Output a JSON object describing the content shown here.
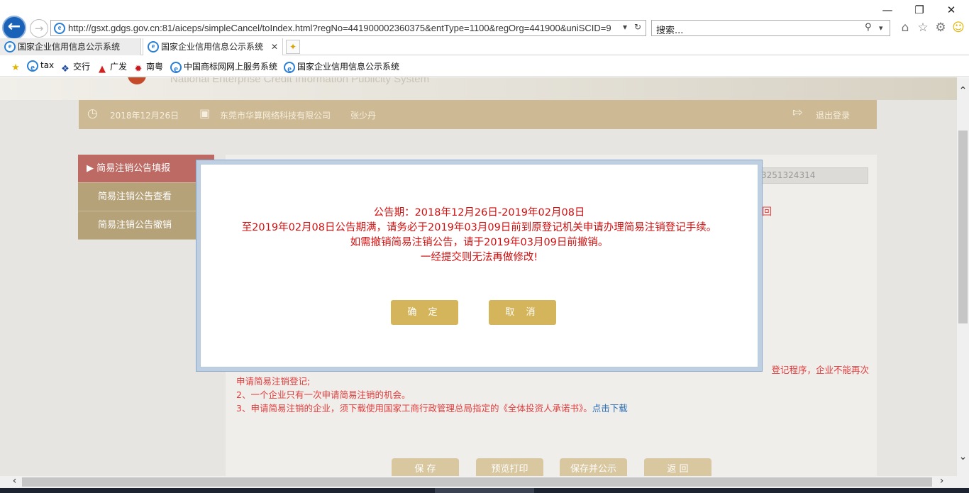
{
  "browser": {
    "url": "http://gsxt.gdgs.gov.cn:81/aiceps/simpleCancel/toIndex.html?regNo=441900002360375&entType=1100&regOrg=441900&uniSCID=9",
    "search_placeholder": "搜索...",
    "tabs": [
      {
        "label": "国家企业信用信息公示系统",
        "active": false
      },
      {
        "label": "国家企业信用信息公示系统",
        "active": true
      }
    ],
    "favorites": [
      "tax",
      "交行",
      "广发",
      "南粤",
      "中国商标网网上服务系统",
      "国家企业信用信息公示系统"
    ]
  },
  "page": {
    "site_name_en": "National Enterprise Credit Information Publicity System",
    "info_bar": {
      "date": "2018年12月26日",
      "company": "东莞市华算网络科技有限公司",
      "user": "张少丹",
      "logout": "退出登录"
    },
    "side_menu": [
      {
        "label": "▶ 简易注销公告填报",
        "active": true
      },
      {
        "label": "简易注销公告查看",
        "active": false
      },
      {
        "label": "简易注销公告撤销",
        "active": false
      }
    ],
    "reg_field_value": "3251324314",
    "red_fragment": "回",
    "notes": [
      "申请简易注销登记;",
      "2、一个企业只有一次申请简易注销的机会。",
      "3、申请简易注销的企业，须下载使用国家工商行政管理总局指定的《全体投资人承诺书》。"
    ],
    "notes_line1_tail": "登记程序，企业不能再次",
    "download_link": "点击下载",
    "bottom_buttons": [
      "保 存",
      "预览打印",
      "保存并公示",
      "返 回"
    ]
  },
  "modal": {
    "lines": [
      "公告期：2018年12月26日-2019年02月08日",
      "至2019年02月08日公告期满，请务必于2019年03月09日前到原登记机关申请办理简易注销登记手续。",
      "如需撤销简易注销公告，请于2019年03月09日前撤销。",
      "一经提交则无法再做修改!"
    ],
    "ok": "确 定",
    "cancel": "取 消"
  },
  "colors": {
    "info_bar": "#cdb993",
    "menu_active": "#bd6a64",
    "menu": "#b5a279",
    "modal_text": "#d30f0f",
    "modal_button": "#d5b55b"
  }
}
